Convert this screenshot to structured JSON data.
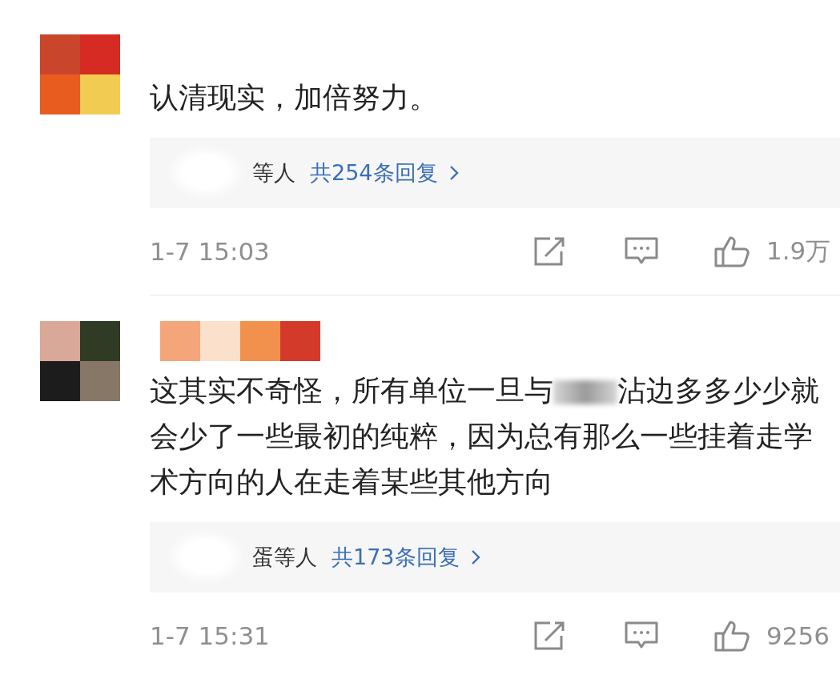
{
  "comments": [
    {
      "text": "认清现实，加倍努力。",
      "replies": {
        "names": "等人",
        "count": "共254条回复"
      },
      "time": "1-7 15:03",
      "likes": "1.9万"
    },
    {
      "text": "这其实不奇怪，所有单位一旦与",
      "text_after_redaction": "沾边多多少少就会少了一些最初的纯粹，因为总有那么一些挂着走学术方向的人在走着某些其他方向",
      "replies": {
        "names": "蛋等人",
        "count": "共173条回复"
      },
      "time": "1-7 15:31",
      "likes": "9256"
    }
  ]
}
